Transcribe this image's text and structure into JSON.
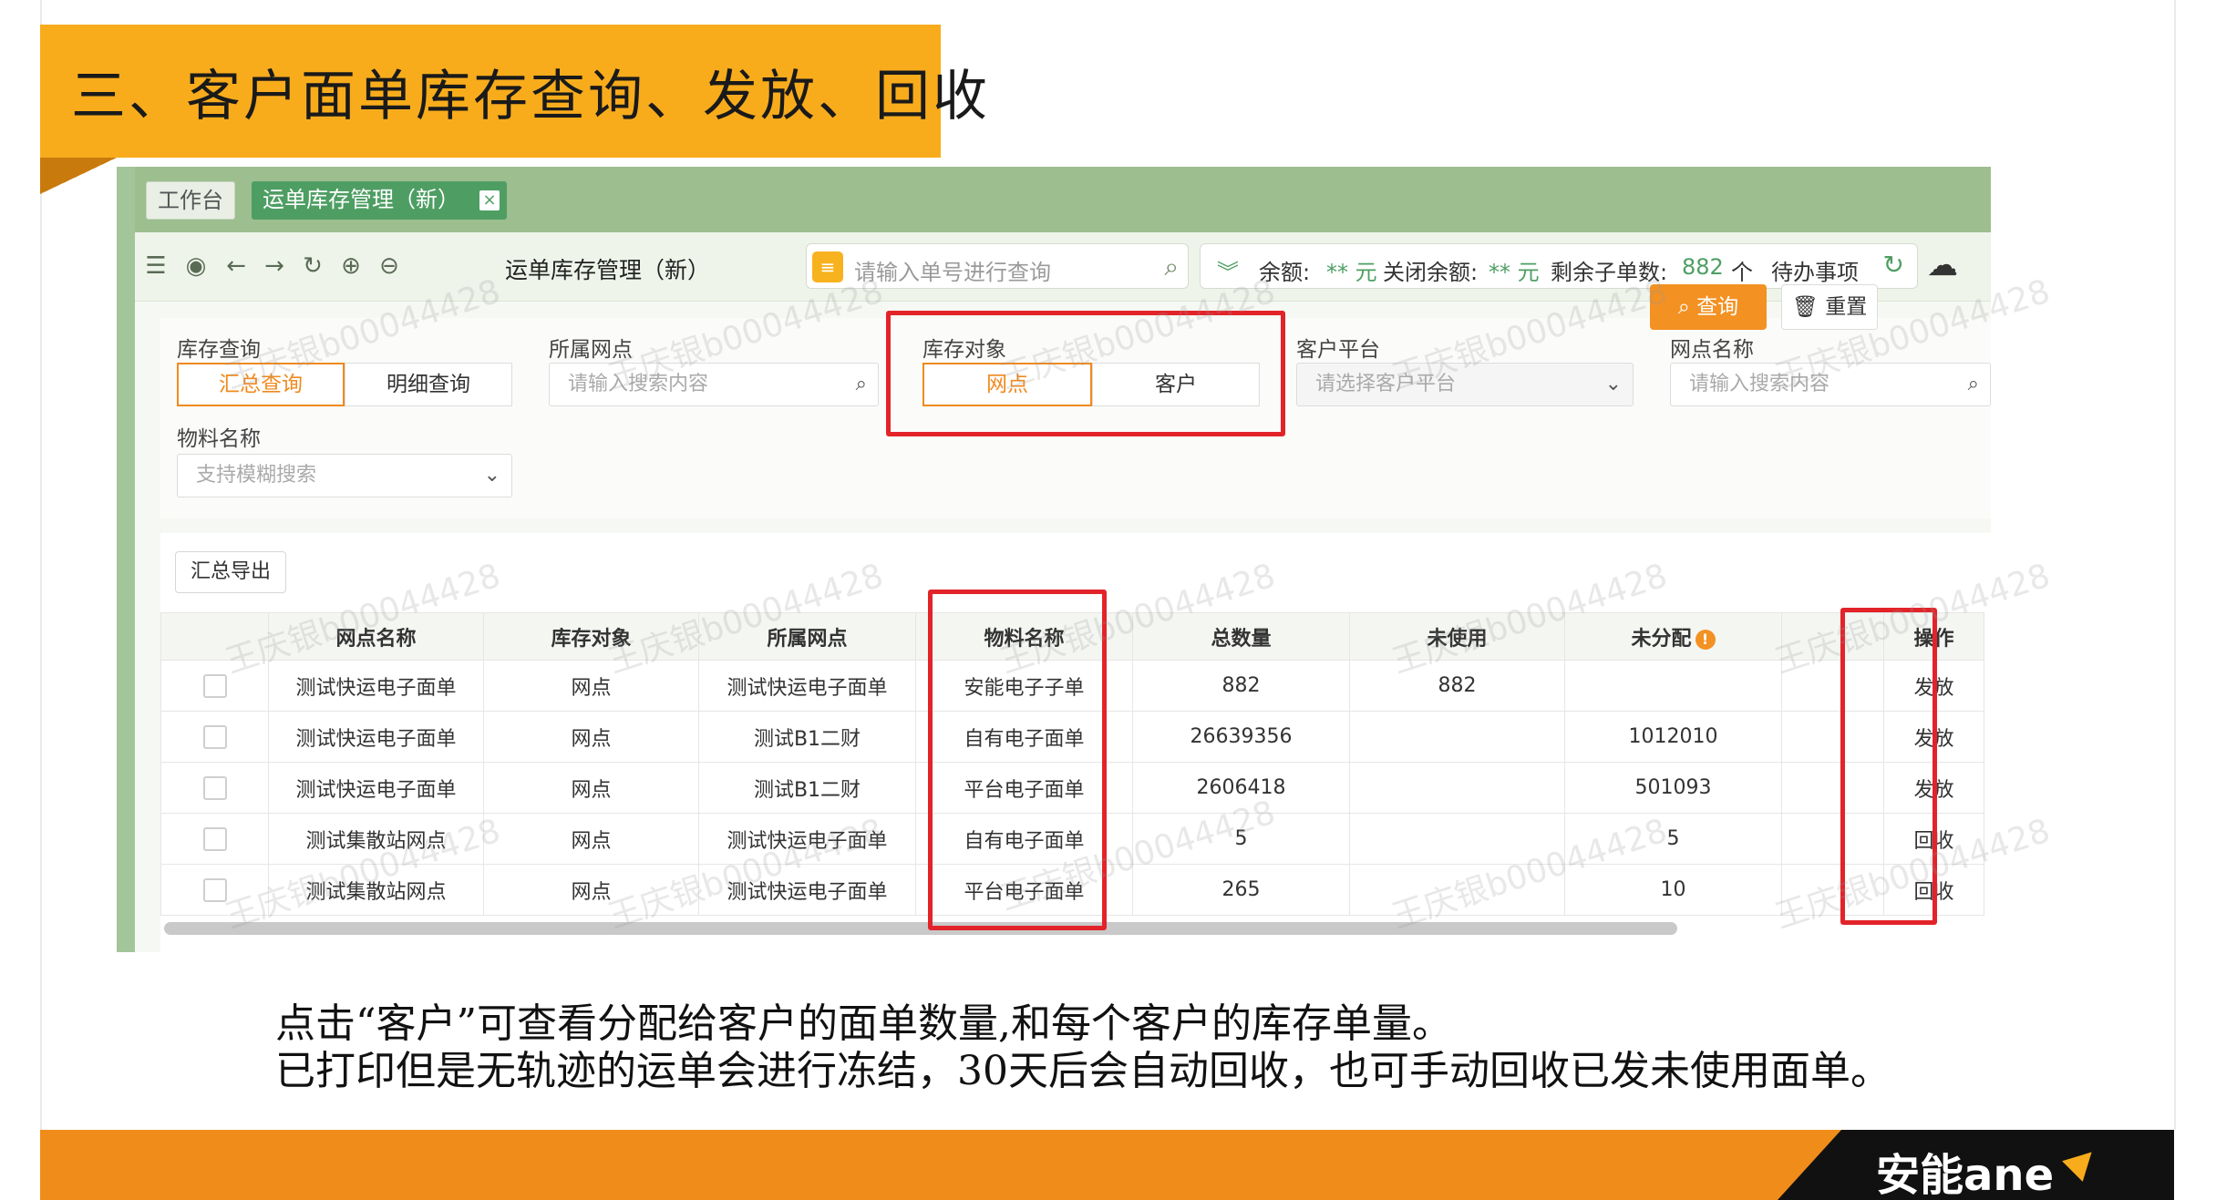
{
  "slide": {
    "title": "三、客户面单库存查询、发放、回收",
    "caption_line1": "点击“客户”可查看分配给客户的面单数量,和每个客户的库存单量。",
    "caption_line2": "已打印但是无轨迹的运单会进行冻结，30天后会自动回收，也可手动回收已发未使用面单。",
    "logo_text": "安能ane"
  },
  "tabs": {
    "workbench": "工作台",
    "active": "运单库存管理（新）",
    "close": "×"
  },
  "toolbar": {
    "page_name": "运单库存管理（新）",
    "search_placeholder": "请输入单号进行查询",
    "balance_label": "余额:",
    "balance_value": "** 元",
    "closed_balance_label": "关闭余额:",
    "closed_balance_value": "** 元",
    "remaining_label": "剩余子单数:",
    "remaining_value": "882",
    "remaining_unit": "个",
    "todo_label": "待办事项",
    "icons": [
      "menu-icon",
      "eye-icon",
      "back-arrow-icon",
      "forward-arrow-icon",
      "refresh-icon",
      "zoom-in-icon",
      "zoom-out-icon"
    ]
  },
  "filter": {
    "stock_query_label": "库存查询",
    "summary_query": "汇总查询",
    "detail_query": "明细查询",
    "branch_label": "所属网点",
    "branch_placeholder": "请输入搜索内容",
    "stock_object_label": "库存对象",
    "object_branch": "网点",
    "object_customer": "客户",
    "platform_label": "客户平台",
    "platform_placeholder": "请选择客户平台",
    "branch_name_label": "网点名称",
    "branch_name_placeholder": "请输入搜索内容",
    "material_label": "物料名称",
    "material_placeholder": "支持模糊搜索",
    "query_button": "查询",
    "reset_button": "重置"
  },
  "table": {
    "export_button": "汇总导出",
    "columns": [
      "网点名称",
      "库存对象",
      "所属网点",
      "物料名称",
      "总数量",
      "未使用",
      "未分配",
      "操作"
    ],
    "rows": [
      [
        "测试快运电子面单",
        "网点",
        "测试快运电子面单",
        "安能电子子单",
        "882",
        "882",
        "",
        "发放"
      ],
      [
        "测试快运电子面单",
        "网点",
        "测试B1二财",
        "自有电子面单",
        "26639356",
        "",
        "1012010",
        "发放"
      ],
      [
        "测试快运电子面单",
        "网点",
        "测试B1二财",
        "平台电子面单",
        "2606418",
        "",
        "501093",
        "发放"
      ],
      [
        "测试集散站网点",
        "网点",
        "测试快运电子面单",
        "自有电子面单",
        "5",
        "",
        "5",
        "回收"
      ],
      [
        "测试集散站网点",
        "网点",
        "测试快运电子面单",
        "平台电子面单",
        "265",
        "",
        "10",
        "回收"
      ]
    ]
  },
  "watermark": "王庆银b00044428",
  "colors": {
    "banner": "#f8ac1c",
    "accent_orange": "#f08a1e",
    "highlight_red": "#e3232a",
    "app_green": "#4e9e63"
  }
}
